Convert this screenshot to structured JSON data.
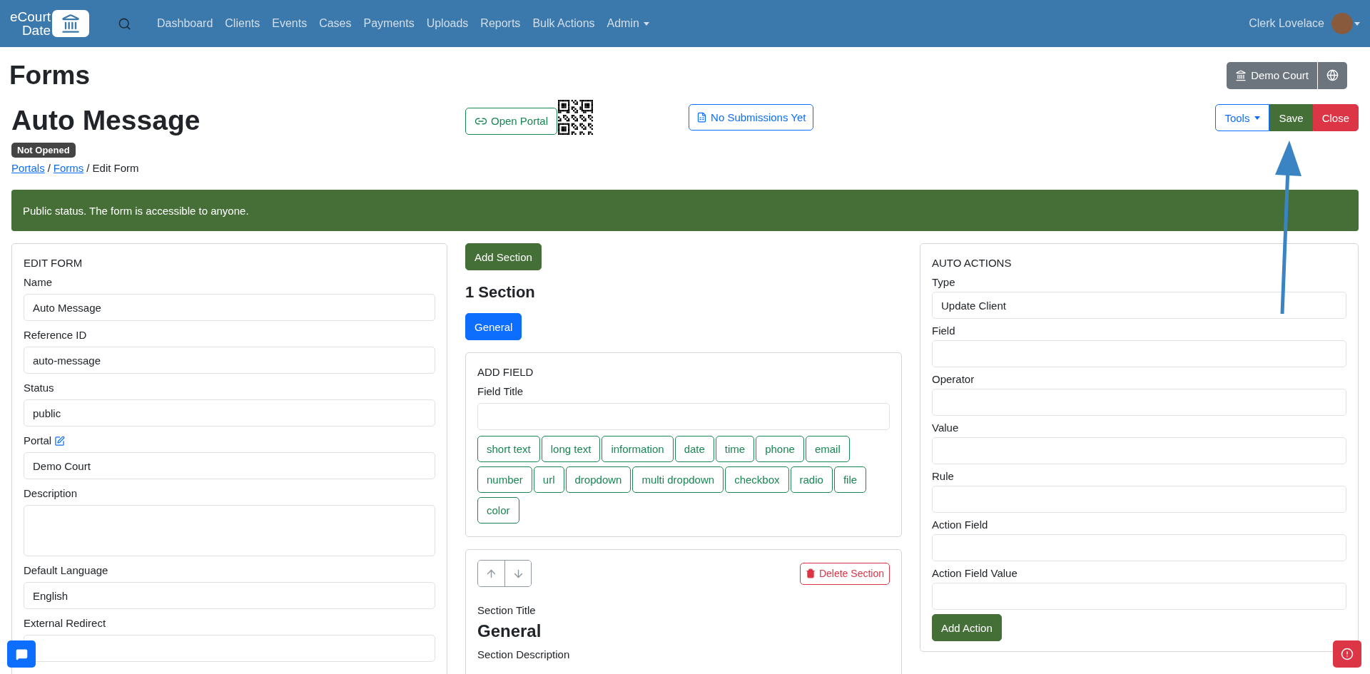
{
  "navbar": {
    "logo_lines": [
      "eCourt",
      "Date"
    ],
    "links": [
      {
        "label": "Dashboard",
        "dropdown": false
      },
      {
        "label": "Clients",
        "dropdown": false
      },
      {
        "label": "Events",
        "dropdown": false
      },
      {
        "label": "Cases",
        "dropdown": false
      },
      {
        "label": "Payments",
        "dropdown": false
      },
      {
        "label": "Uploads",
        "dropdown": false
      },
      {
        "label": "Reports",
        "dropdown": false
      },
      {
        "label": "Bulk Actions",
        "dropdown": false
      },
      {
        "label": "Admin",
        "dropdown": true
      }
    ],
    "user": "Clerk Lovelace"
  },
  "page_title": "Forms",
  "court_button": "Demo Court",
  "form": {
    "title": "Auto Message",
    "status_badge": "Not Opened",
    "open_portal": "Open Portal",
    "submissions": "No Submissions Yet",
    "actions": [
      {
        "label": "Tools",
        "kind": "dropdown"
      },
      {
        "label": "Save",
        "kind": "save"
      },
      {
        "label": "Close",
        "kind": "close"
      }
    ]
  },
  "breadcrumb": {
    "separator": "/",
    "items": [
      {
        "label": "Portals",
        "link": true
      },
      {
        "label": "Forms",
        "link": true
      },
      {
        "label": "Edit Form",
        "link": false
      }
    ]
  },
  "alert": "Public status. The form is accessible to anyone.",
  "edit_form": {
    "heading": "EDIT FORM",
    "fields": [
      {
        "label": "Name",
        "value": "Auto Message",
        "kind": "input",
        "edit_icon": false
      },
      {
        "label": "Reference ID",
        "value": "auto-message",
        "kind": "input",
        "edit_icon": false
      },
      {
        "label": "Status",
        "value": "public",
        "kind": "input",
        "edit_icon": false
      },
      {
        "label": "Portal",
        "value": "Demo Court",
        "kind": "input",
        "edit_icon": true
      },
      {
        "label": "Description",
        "kind": "textarea",
        "edit_icon": false
      },
      {
        "label": "Default Language",
        "value": "English",
        "kind": "input",
        "edit_icon": false
      },
      {
        "label": "External Redirect",
        "kind": "input",
        "edit_icon": false
      }
    ]
  },
  "sections": {
    "add_button": "Add Section",
    "count": "1 Section",
    "tabs": [
      {
        "label": "General",
        "selected": true
      }
    ],
    "add_field": {
      "heading": "ADD FIELD",
      "title_label": "Field Title",
      "types": [
        "short text",
        "long text",
        "information",
        "date",
        "time",
        "phone",
        "email",
        "number",
        "url",
        "dropdown",
        "multi dropdown",
        "checkbox",
        "radio",
        "file",
        "color"
      ]
    },
    "section_card": {
      "delete": "Delete Section",
      "title_label": "Section Title",
      "title": "General",
      "description_label": "Section Description"
    }
  },
  "auto_actions": {
    "heading": "AUTO ACTIONS",
    "fields": [
      {
        "label": "Type",
        "value": "Update Client"
      },
      {
        "label": "Field"
      },
      {
        "label": "Operator"
      },
      {
        "label": "Value"
      },
      {
        "label": "Rule"
      },
      {
        "label": "Action Field"
      },
      {
        "label": "Action Field Value"
      }
    ],
    "button": "Add Action"
  }
}
